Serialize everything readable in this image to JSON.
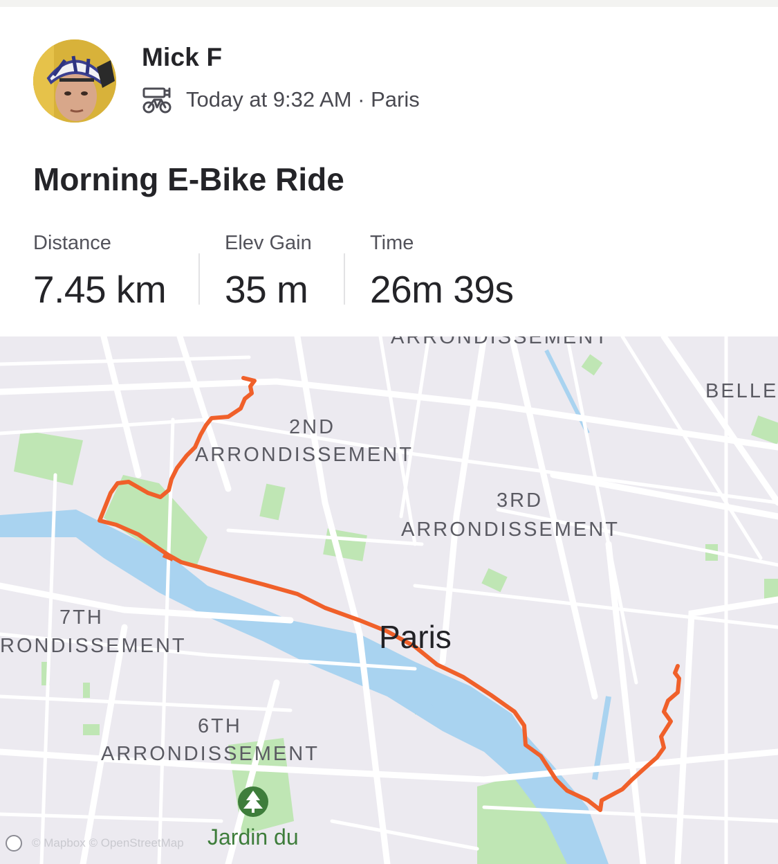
{
  "athlete": {
    "name": "Mick F"
  },
  "activity": {
    "sport_icon": "e-bike-icon",
    "meta": "Today at 9:32 AM · Paris",
    "title": "Morning E-Bike Ride"
  },
  "stats": [
    {
      "label": "Distance",
      "value": "7.45 km"
    },
    {
      "label": "Elev Gain",
      "value": "35 m"
    },
    {
      "label": "Time",
      "value": "26m 39s"
    }
  ],
  "map": {
    "labels": {
      "top_cut": "ARRONDISSEMENT",
      "second": "2ND",
      "second_arr": "ARRONDISSEMENT",
      "third": "3RD",
      "third_arr": "ARRONDISSEMENT",
      "seventh": "7TH",
      "seventh_arr": "RONDISSEMENT",
      "sixth": "6TH",
      "sixth_arr": "ARRONDISSEMENT",
      "belleville": "BELLE",
      "city": "Paris",
      "park": "Jardin du"
    },
    "park_icon": "tree-icon",
    "attribution": "© Mapbox © OpenStreetMap",
    "colors": {
      "route": "#f0602a",
      "water": "#a9d3f0",
      "park": "#bfe6b4",
      "land": "#eceaf0",
      "road": "#ffffff"
    }
  }
}
